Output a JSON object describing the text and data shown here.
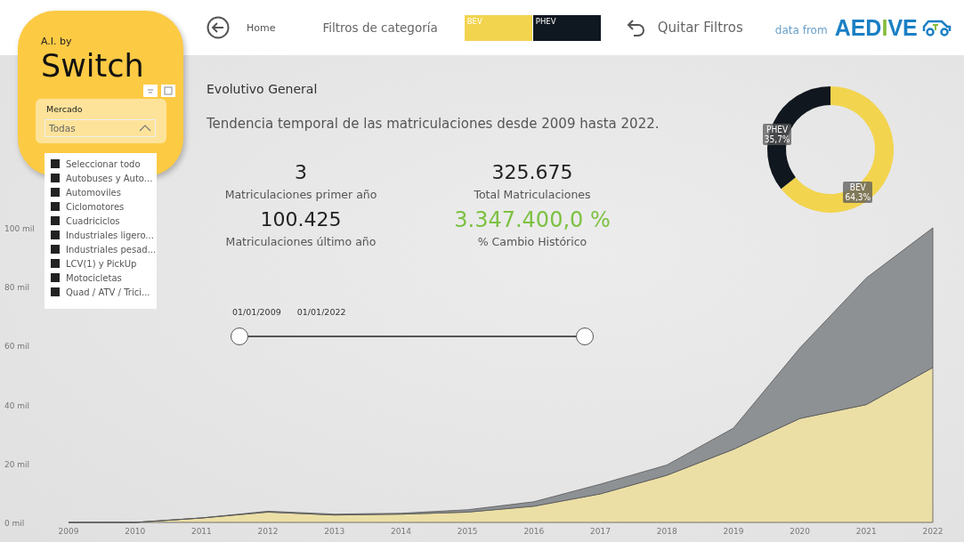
{
  "logo": {
    "prefix": "A.I. by",
    "name": "Switch"
  },
  "nav": {
    "home": "Home",
    "filters_label": "Filtros de categoría",
    "clear": "Quitar Filtros",
    "source_prefix": "data from",
    "source": "AEDIVE"
  },
  "category_tiles": [
    {
      "label": "BEV",
      "color": "#f2d44f"
    },
    {
      "label": "PHEV",
      "color": "#0f1720"
    }
  ],
  "slicer": {
    "title": "Mercado",
    "value": "Todas",
    "expanded": true,
    "options": [
      {
        "label": "Seleccionar todo",
        "checked": true
      },
      {
        "label": "Autobuses y Auto...",
        "checked": true
      },
      {
        "label": "Automoviles",
        "checked": true
      },
      {
        "label": "Ciclomotores",
        "checked": true
      },
      {
        "label": "Cuadriciclos",
        "checked": true
      },
      {
        "label": "Industriales ligero...",
        "checked": true
      },
      {
        "label": "Industriales pesad...",
        "checked": true
      },
      {
        "label": "LCV(1) y PickUp",
        "checked": true
      },
      {
        "label": "Motocicletas",
        "checked": true
      },
      {
        "label": "Quad / ATV / Trici...",
        "checked": true
      }
    ]
  },
  "title": "Evolutivo General",
  "subtitle": "Tendencia temporal de las matriculaciones desde 2009 hasta 2022.",
  "kpis": [
    {
      "value": "3",
      "label": "Matriculaciones primer año",
      "kind": "plain"
    },
    {
      "value": "325.675",
      "label": "Total Matriculaciones",
      "kind": "plain"
    },
    {
      "value": "100.425",
      "label": "Matriculaciones último año",
      "kind": "plain"
    },
    {
      "value": "3.347.400,0 %",
      "label": "% Cambio Histórico",
      "kind": "positive"
    }
  ],
  "date_range": {
    "start": "01/01/2009",
    "end": "01/01/2022",
    "thumbs": [
      {
        "level": 0
      },
      {
        "level": 1
      }
    ]
  },
  "donut": {
    "chart_data": {
      "type": "donut",
      "categories": [
        "BEV",
        "PHEV"
      ],
      "values": [
        64.3,
        35.7
      ],
      "value_labels": [
        "64,3%",
        "35,7%"
      ],
      "colors": [
        "#f2d44f",
        "#10171f"
      ]
    }
  },
  "area": {
    "chart_data": {
      "type": "area",
      "stacked": true,
      "categories": [
        "2009",
        "2010",
        "2011",
        "2012",
        "2013",
        "2014",
        "2015",
        "2016",
        "2017",
        "2018",
        "2019",
        "2020",
        "2021",
        "2022"
      ],
      "ylim": [
        0,
        100
      ],
      "yticks": [
        {
          "value": 0,
          "label": "0 mil"
        },
        {
          "value": 20,
          "label": "20 mil"
        },
        {
          "value": 40,
          "label": "40 mil"
        },
        {
          "value": 60,
          "label": "60 mil"
        },
        {
          "value": 80,
          "label": "80 mil"
        },
        {
          "value": 100,
          "label": "100 mil"
        }
      ],
      "series": [
        {
          "color": "#ebdfa6",
          "values": [
            0,
            0,
            1.5,
            3.5,
            2.5,
            2.8,
            3.5,
            5.5,
            9.7,
            16,
            24.8,
            35.3,
            40,
            52.6
          ]
        },
        {
          "color": "#8e9194",
          "values": [
            0,
            0,
            0,
            0.3,
            0.3,
            0.3,
            0.8,
            1.5,
            3.3,
            3.5,
            7.2,
            23.9,
            43,
            47.4
          ]
        }
      ]
    }
  }
}
